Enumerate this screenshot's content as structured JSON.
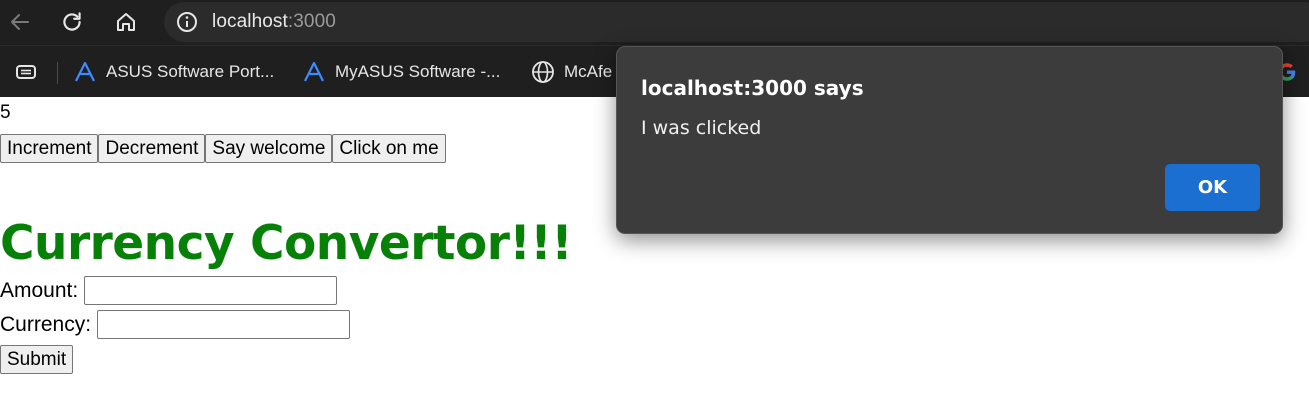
{
  "browser": {
    "url_host": "localhost",
    "url_port": ":3000",
    "bookmarks": [
      {
        "label": "ASUS Software Port...",
        "icon": "asus-logo-icon"
      },
      {
        "label": "MyASUS Software -...",
        "icon": "asus-logo-icon"
      },
      {
        "label": "McAfe",
        "icon": "globe-icon"
      }
    ]
  },
  "page": {
    "count": "5",
    "buttons": {
      "increment": "Increment",
      "decrement": "Decrement",
      "say_welcome": "Say welcome",
      "click_me": "Click on me"
    },
    "heading": "Currency Convertor!!!",
    "heading_color": "#078007",
    "form": {
      "amount_label": "Amount:",
      "amount_value": "",
      "currency_label": "Currency:",
      "currency_value": "",
      "submit_label": "Submit"
    }
  },
  "dialog": {
    "title": "localhost:3000 says",
    "message": "I was clicked",
    "ok_label": "OK",
    "ok_color": "#1a6fd0"
  }
}
